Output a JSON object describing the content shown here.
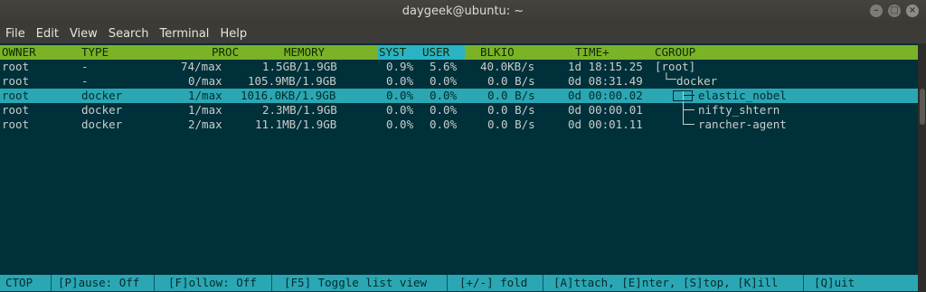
{
  "window": {
    "title": "daygeek@ubuntu: ~"
  },
  "menu": [
    "File",
    "Edit",
    "View",
    "Search",
    "Terminal",
    "Help"
  ],
  "colors": {
    "header": "#7ab327",
    "selected": "#2aa7b3",
    "background": "#00303a"
  },
  "table": {
    "headers": [
      "OWNER",
      "TYPE",
      "PROC",
      "MEMORY",
      "SYST",
      "USER",
      "BLKIO",
      "TIME+",
      "CGROUP"
    ],
    "rows": [
      {
        "owner": "root",
        "type": "-",
        "proc": "74/max",
        "memory": "1.5GB/1.9GB",
        "syst": "0.9%",
        "user": "5.6%",
        "blkio": "40.0KB/s",
        "time": "1d 18:15.25",
        "cgroup": "[root]"
      },
      {
        "owner": "root",
        "type": "-",
        "proc": "0/max",
        "memory": "105.9MB/1.9GB",
        "syst": "0.0%",
        "user": "0.0%",
        "blkio": "0.0 B/s",
        "time": "0d 08:31.49",
        "cgroup": "docker"
      },
      {
        "owner": "root",
        "type": "docker",
        "proc": "1/max",
        "memory": "1016.0KB/1.9GB",
        "syst": "0.0%",
        "user": "0.0%",
        "blkio": "0.0 B/s",
        "time": "0d 00:00.02",
        "cgroup": "elastic_nobel"
      },
      {
        "owner": "root",
        "type": "docker",
        "proc": "1/max",
        "memory": "2.3MB/1.9GB",
        "syst": "0.0%",
        "user": "0.0%",
        "blkio": "0.0 B/s",
        "time": "0d 00:00.01",
        "cgroup": "nifty_shtern"
      },
      {
        "owner": "root",
        "type": "docker",
        "proc": "2/max",
        "memory": "11.1MB/1.9GB",
        "syst": "0.0%",
        "user": "0.0%",
        "blkio": "0.0 B/s",
        "time": "0d 00:01.11",
        "cgroup": "rancher-agent"
      }
    ],
    "selected_row": 2
  },
  "statusbar": {
    "app": "CTOP",
    "pause": "[P]ause: Off",
    "follow": "[F]ollow: Off",
    "toggle": "[F5] Toggle list view",
    "fold": "[+/-] fold",
    "actions": "[A]ttach, [E]nter, [S]top, [K]ill",
    "quit": "[Q]uit"
  }
}
